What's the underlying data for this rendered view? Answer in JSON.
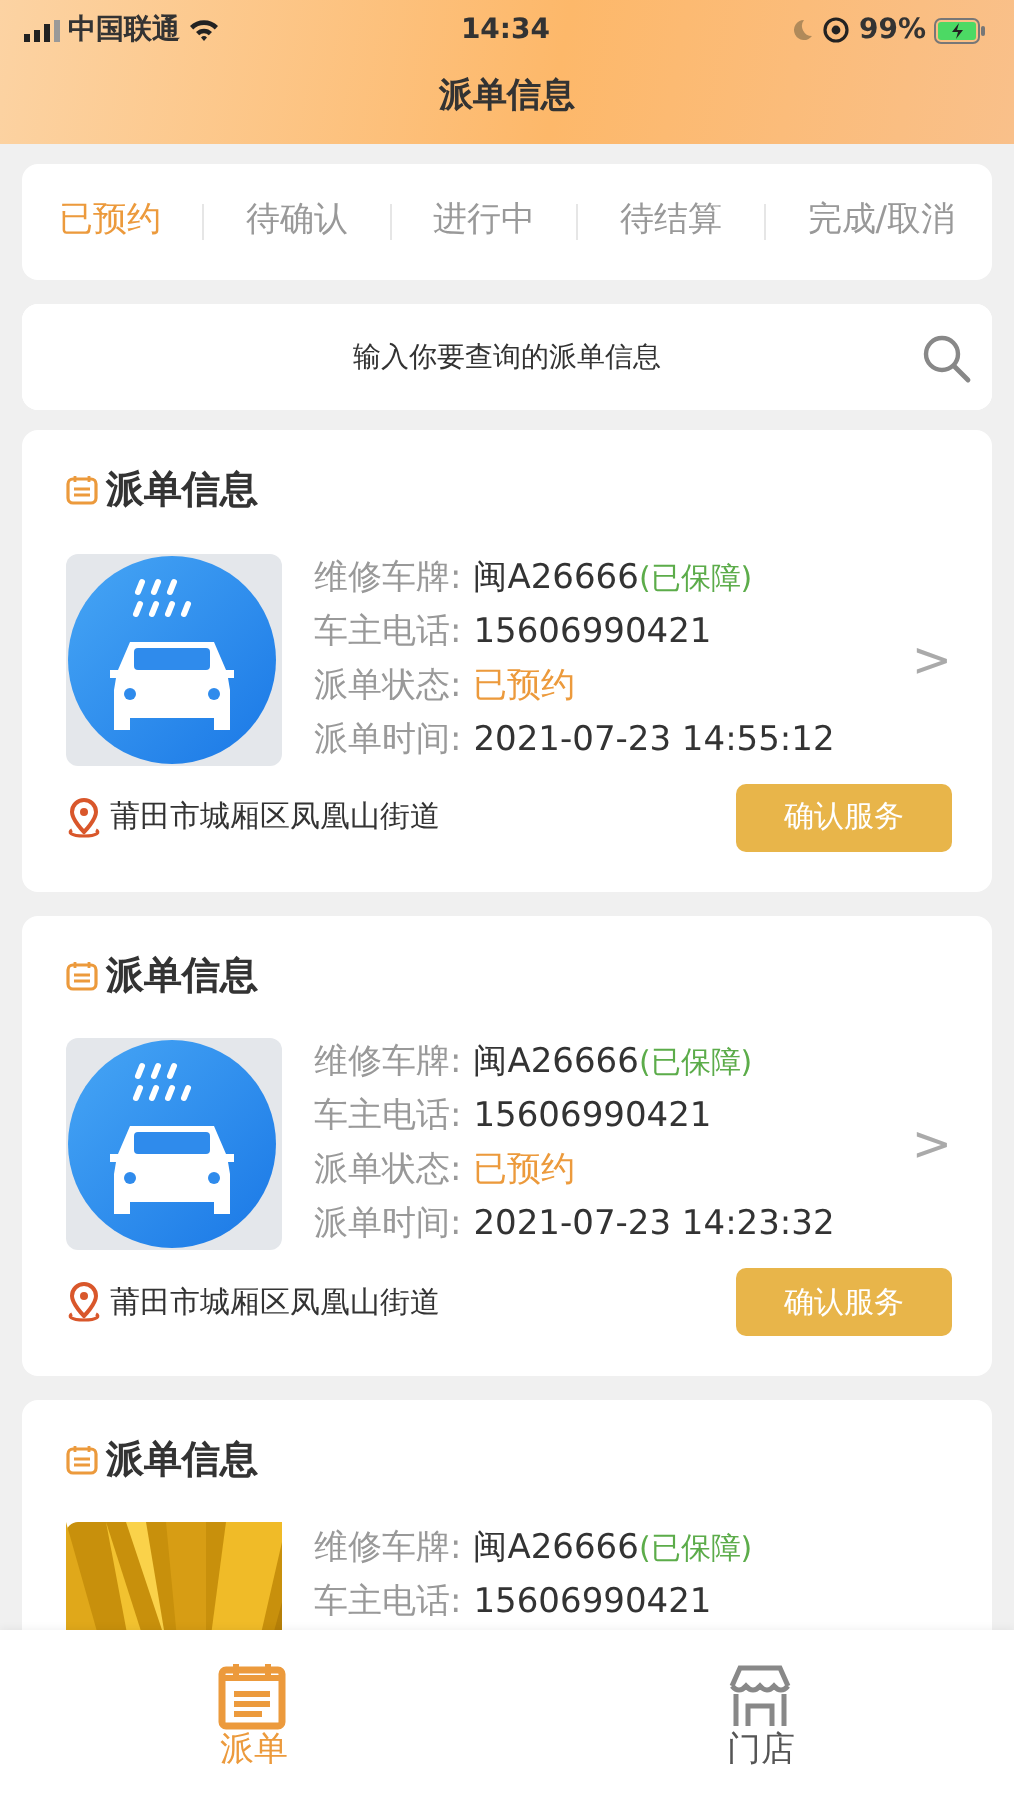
{
  "status_bar": {
    "carrier": "中国联通",
    "time": "14:34",
    "battery": "99%",
    "charging": true
  },
  "header": {
    "title": "派单信息"
  },
  "tabs": [
    {
      "label": "已预约",
      "selected": true
    },
    {
      "label": "待确认",
      "selected": false
    },
    {
      "label": "进行中",
      "selected": false
    },
    {
      "label": "待结算",
      "selected": false
    },
    {
      "label": "完成/取消",
      "selected": false
    }
  ],
  "search": {
    "placeholder": "输入你要查询的派单信息"
  },
  "orders": [
    {
      "title": "派单信息",
      "image": {
        "kind": "icon"
      },
      "fields": [
        {
          "label": "维修车牌:",
          "value": "闽A26666",
          "note": "(已保障)",
          "kind": "plain"
        },
        {
          "label": "车主电话:",
          "value": "15606990421",
          "kind": "plain"
        },
        {
          "label": "派单状态:",
          "value": "已预约",
          "kind": "status"
        },
        {
          "label": "派单时间:",
          "value": "2021-07-23 14:55:12",
          "kind": "plain"
        }
      ],
      "chevron": ">",
      "address": "莆田市城厢区凤凰山街道",
      "button": "确认服务"
    },
    {
      "title": "派单信息",
      "image": {
        "kind": "icon"
      },
      "fields": [
        {
          "label": "维修车牌:",
          "value": "闽A26666",
          "note": "(已保障)",
          "kind": "plain"
        },
        {
          "label": "车主电话:",
          "value": "15606990421",
          "kind": "plain"
        },
        {
          "label": "派单状态:",
          "value": "已预约",
          "kind": "status"
        },
        {
          "label": "派单时间:",
          "value": "2021-07-23 14:23:32",
          "kind": "plain"
        }
      ],
      "chevron": ">",
      "address": "莆田市城厢区凤凰山街道",
      "button": "确认服务"
    },
    {
      "title": "派单信息",
      "image": {
        "kind": "picture"
      },
      "fields": [
        {
          "label": "维修车牌:",
          "value": "闽A26666",
          "note": "(已保障)",
          "kind": "plain"
        },
        {
          "label": "车主电话:",
          "value": "15606990421",
          "kind": "plain"
        }
      ]
    }
  ],
  "bottom_nav": [
    {
      "label": "派单",
      "selected": true,
      "kind": "calendar"
    },
    {
      "label": "门店",
      "selected": false,
      "kind": "store"
    }
  ]
}
